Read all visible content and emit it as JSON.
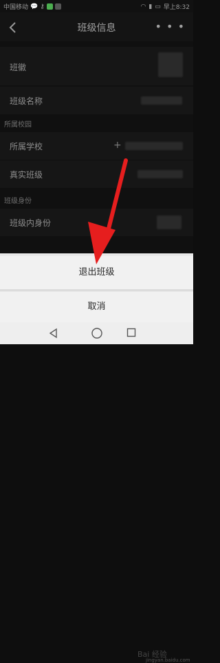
{
  "status": {
    "carrier": "中国移动",
    "time": "早上8:32"
  },
  "header": {
    "title": "班级信息",
    "more": "• • •"
  },
  "rows": {
    "badge": "班徽",
    "class_name": "班级名称",
    "section_school": "所属校园",
    "school": "所属学校",
    "real_class": "真实班级",
    "section_role": "班级身份",
    "role": "班级内身份"
  },
  "sheet": {
    "exit": "退出班级",
    "cancel": "取消"
  },
  "watermark": {
    "logo": "Bai 经验",
    "url": "jingyan.baidu.com"
  },
  "colors": {
    "arrow": "#e61e1e"
  }
}
